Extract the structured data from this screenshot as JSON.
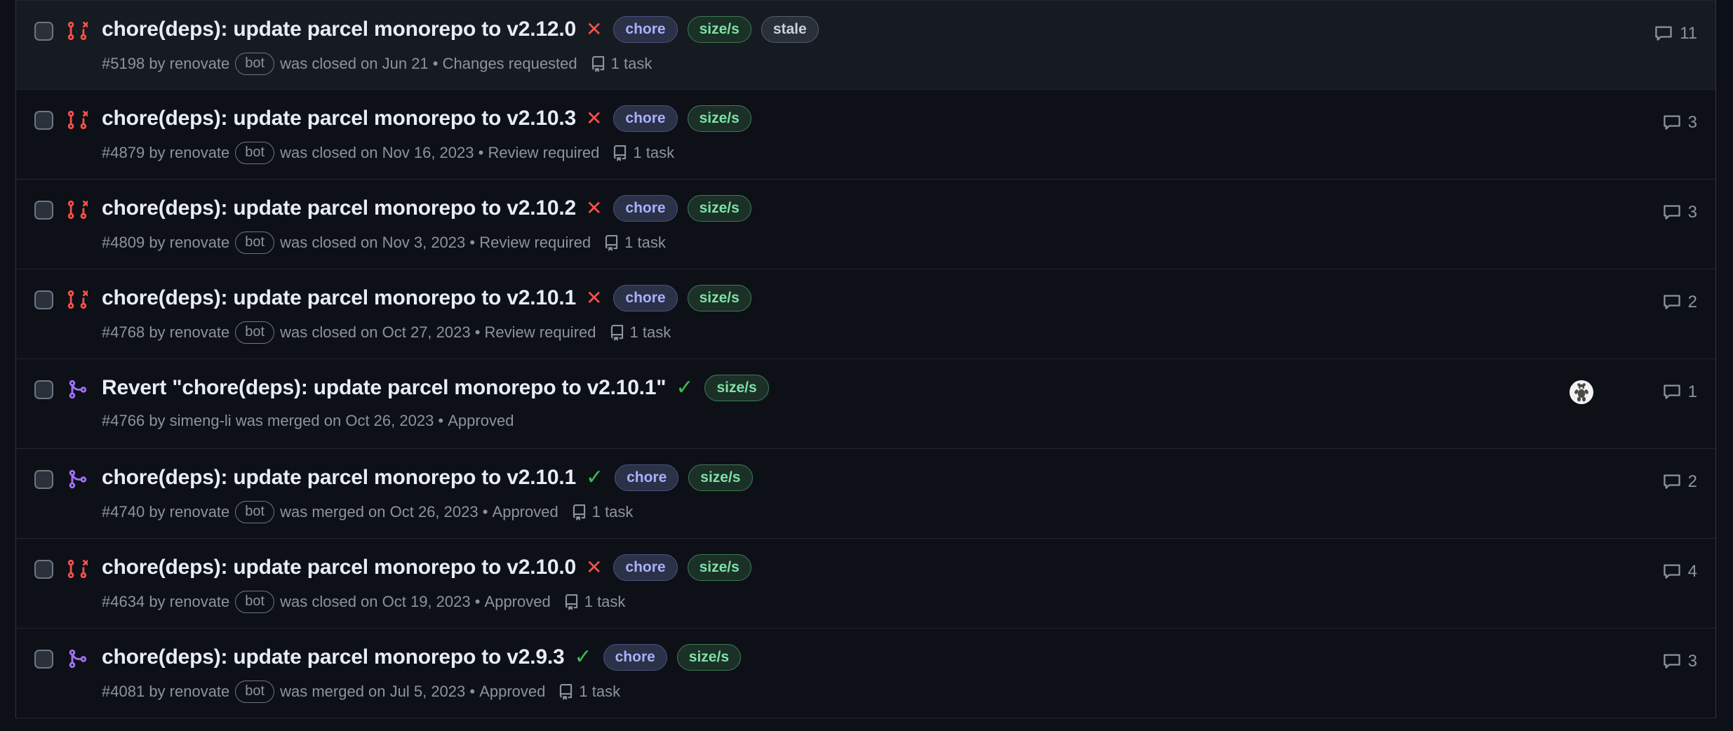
{
  "colors": {
    "background": "#0d1117",
    "row_highlight": "#161b22",
    "border": "#21262d",
    "title": "#e6edf3",
    "meta": "#8b949e",
    "closed_red": "#f85149",
    "merged_purple": "#a371f7",
    "check_green": "#3fb950",
    "label_chore_text": "#a8b1ff",
    "label_size_text": "#7ee2a8",
    "label_stale_text": "#c9d1d9"
  },
  "icons": {
    "checkbox": "checkbox-icon",
    "pr_closed": "pull-request-closed-icon",
    "pr_merged": "git-merge-icon",
    "check": "check-icon",
    "x": "x-icon",
    "tasklist": "tasklist-icon",
    "comment": "comment-icon",
    "avatar": "avatar-icon"
  },
  "rows": [
    {
      "state": "closed",
      "highlight": true,
      "title": "chore(deps): update parcel monorepo to v2.12.0",
      "status_mark": "x",
      "status_symbol": "✕",
      "labels": [
        "chore",
        "size/s",
        "stale"
      ],
      "number": "#5198",
      "author_prefix": "by renovate",
      "bot": "bot",
      "action": "was closed on Jun 21",
      "separator": "•",
      "review": "Changes requested",
      "tasks": "1 task",
      "comments": "11",
      "avatar": false
    },
    {
      "state": "closed",
      "highlight": false,
      "title": "chore(deps): update parcel monorepo to v2.10.3",
      "status_mark": "x",
      "status_symbol": "✕",
      "labels": [
        "chore",
        "size/s"
      ],
      "number": "#4879",
      "author_prefix": "by renovate",
      "bot": "bot",
      "action": "was closed on Nov 16, 2023",
      "separator": "•",
      "review": "Review required",
      "tasks": "1 task",
      "comments": "3",
      "avatar": false
    },
    {
      "state": "closed",
      "highlight": false,
      "title": "chore(deps): update parcel monorepo to v2.10.2",
      "status_mark": "x",
      "status_symbol": "✕",
      "labels": [
        "chore",
        "size/s"
      ],
      "number": "#4809",
      "author_prefix": "by renovate",
      "bot": "bot",
      "action": "was closed on Nov 3, 2023",
      "separator": "•",
      "review": "Review required",
      "tasks": "1 task",
      "comments": "3",
      "avatar": false
    },
    {
      "state": "closed",
      "highlight": false,
      "title": "chore(deps): update parcel monorepo to v2.10.1",
      "status_mark": "x",
      "status_symbol": "✕",
      "labels": [
        "chore",
        "size/s"
      ],
      "number": "#4768",
      "author_prefix": "by renovate",
      "bot": "bot",
      "action": "was closed on Oct 27, 2023",
      "separator": "•",
      "review": "Review required",
      "tasks": "1 task",
      "comments": "2",
      "avatar": false
    },
    {
      "state": "merged",
      "highlight": false,
      "title": "Revert \"chore(deps): update parcel monorepo to v2.10.1\"",
      "status_mark": "check",
      "status_symbol": "✓",
      "labels": [
        "size/s"
      ],
      "number": "#4766",
      "author_prefix": "by simeng-li",
      "bot": "",
      "action": "was merged on Oct 26, 2023",
      "separator": "•",
      "review": "Approved",
      "tasks": "",
      "comments": "1",
      "avatar": true
    },
    {
      "state": "merged",
      "highlight": false,
      "title": "chore(deps): update parcel monorepo to v2.10.1",
      "status_mark": "check",
      "status_symbol": "✓",
      "labels": [
        "chore",
        "size/s"
      ],
      "number": "#4740",
      "author_prefix": "by renovate",
      "bot": "bot",
      "action": "was merged on Oct 26, 2023",
      "separator": "•",
      "review": "Approved",
      "tasks": "1 task",
      "comments": "2",
      "avatar": false
    },
    {
      "state": "closed",
      "highlight": false,
      "title": "chore(deps): update parcel monorepo to v2.10.0",
      "status_mark": "x",
      "status_symbol": "✕",
      "labels": [
        "chore",
        "size/s"
      ],
      "number": "#4634",
      "author_prefix": "by renovate",
      "bot": "bot",
      "action": "was closed on Oct 19, 2023",
      "separator": "•",
      "review": "Approved",
      "tasks": "1 task",
      "comments": "4",
      "avatar": false
    },
    {
      "state": "merged",
      "highlight": false,
      "title": "chore(deps): update parcel monorepo to v2.9.3",
      "status_mark": "check",
      "status_symbol": "✓",
      "labels": [
        "chore",
        "size/s"
      ],
      "number": "#4081",
      "author_prefix": "by renovate",
      "bot": "bot",
      "action": "was merged on Jul 5, 2023",
      "separator": "•",
      "review": "Approved",
      "tasks": "1 task",
      "comments": "3",
      "avatar": false
    }
  ]
}
